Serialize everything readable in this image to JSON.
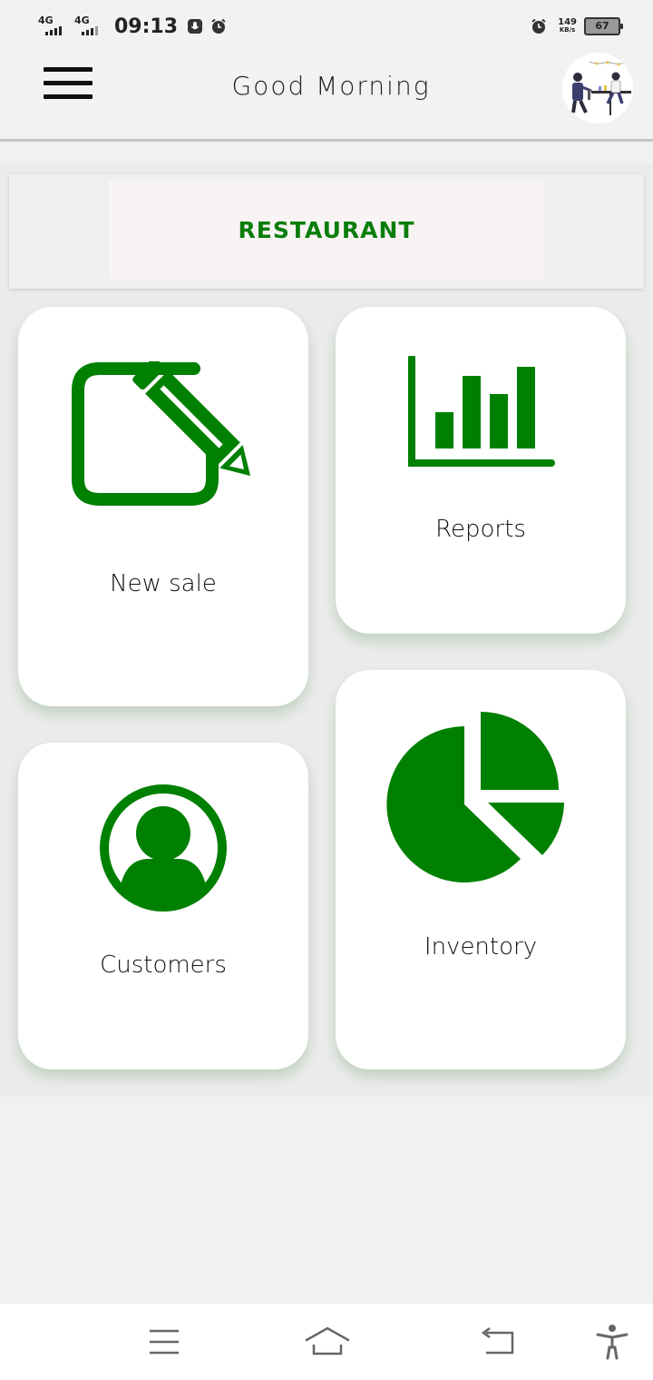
{
  "status_bar": {
    "network_1": "4G",
    "network_2": "4G",
    "time": "09:13",
    "speed_value": "149",
    "speed_unit": "KB/s",
    "battery": "67"
  },
  "header": {
    "greeting": "Good Morning",
    "menu_icon": "hamburger-menu-icon",
    "avatar": "restaurant-illustration-avatar"
  },
  "banner": {
    "title": "RESTAURANT"
  },
  "tiles": [
    {
      "label": "New sale",
      "icon": "edit-icon"
    },
    {
      "label": "Reports",
      "icon": "bar-chart-icon"
    },
    {
      "label": "Customers",
      "icon": "user-circle-icon"
    },
    {
      "label": "Inventory",
      "icon": "pie-chart-icon"
    }
  ],
  "colors": {
    "accent": "#008000",
    "background": "#f1f1f1",
    "card": "#ffffff"
  },
  "nav_bar": {
    "icons": [
      "menu-icon",
      "home-icon",
      "back-icon",
      "accessibility-icon"
    ]
  }
}
